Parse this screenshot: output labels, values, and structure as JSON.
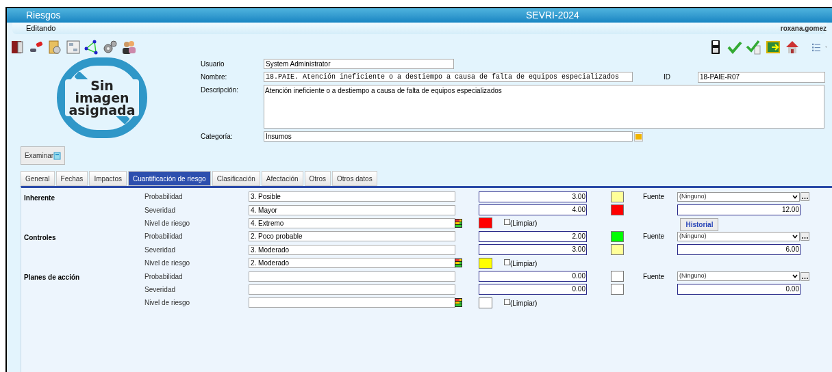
{
  "window": {
    "title": "Riesgos",
    "app_title": "SEVRI-2024"
  },
  "subheader": {
    "mode": "Editando",
    "user": "roxana.gomez"
  },
  "image_placeholder": {
    "text": "Sin imagen asignada"
  },
  "browse_button": "Examinar",
  "form": {
    "usuario": {
      "label": "Usuario",
      "value": "System Administrator"
    },
    "nombre": {
      "label": "Nombre:",
      "value": "18.PAIE. Atención ineficiente o a destiempo a causa de falta de equipos especializados"
    },
    "id": {
      "label": "ID",
      "value": "18-PAIE-R07"
    },
    "descripcion": {
      "label": "Descripción:",
      "value": "Atención ineficiente o a destiempo a causa de falta de equipos especializados"
    },
    "categoria": {
      "label": "Categoría:",
      "value": "Insumos"
    }
  },
  "tabs": [
    {
      "label": "General",
      "selected": false
    },
    {
      "label": "Fechas",
      "selected": false
    },
    {
      "label": "Impactos",
      "selected": false
    },
    {
      "label": "Cuantificación de riesgo",
      "selected": true
    },
    {
      "label": "Clasificación",
      "selected": false
    },
    {
      "label": "Afectación",
      "selected": false
    },
    {
      "label": "Otros",
      "selected": false
    },
    {
      "label": "Otros datos",
      "selected": false
    }
  ],
  "groups": [
    {
      "label": "Inherente",
      "fuente_label": "Fuente",
      "fuente": "(Ninguno)",
      "total": "12.00",
      "history_button": "Historial",
      "rows": [
        {
          "kind": "score",
          "label": "Probabilidad",
          "value": "3. Posible",
          "number": "3.00",
          "color": "#ffff99"
        },
        {
          "kind": "score",
          "label": "Severidad",
          "value": "4. Mayor",
          "number": "4.00",
          "color": "#ff0000"
        },
        {
          "kind": "level",
          "label": "Nivel de riesgo",
          "value": "4. Extremo",
          "color": "#ff0000",
          "clear_label": "(Limpiar)",
          "clear_checked": false
        }
      ]
    },
    {
      "label": "Controles",
      "fuente_label": "Fuente",
      "fuente": "(Ninguno)",
      "total": "6.00",
      "rows": [
        {
          "kind": "score",
          "label": "Probabilidad",
          "value": "2. Poco probable",
          "number": "2.00",
          "color": "#00ff00"
        },
        {
          "kind": "score",
          "label": "Severidad",
          "value": "3. Moderado",
          "number": "3.00",
          "color": "#ffff99"
        },
        {
          "kind": "level",
          "label": "Nivel de riesgo",
          "value": "2. Moderado",
          "color": "#ffff00",
          "clear_label": "(Limpiar)",
          "clear_checked": false
        }
      ]
    },
    {
      "label": "Planes de acción",
      "fuente_label": "Fuente",
      "fuente": "(Ninguno)",
      "total": "0.00",
      "rows": [
        {
          "kind": "score",
          "label": "Probabilidad",
          "value": "",
          "number": "0.00",
          "color": "#ffffff"
        },
        {
          "kind": "score",
          "label": "Severidad",
          "value": "",
          "number": "0.00",
          "color": "#ffffff"
        },
        {
          "kind": "level",
          "label": "Nivel de riesgo",
          "value": "",
          "color": "#ffffff",
          "clear_label": "(Limpiar)",
          "clear_checked": false
        }
      ]
    }
  ]
}
